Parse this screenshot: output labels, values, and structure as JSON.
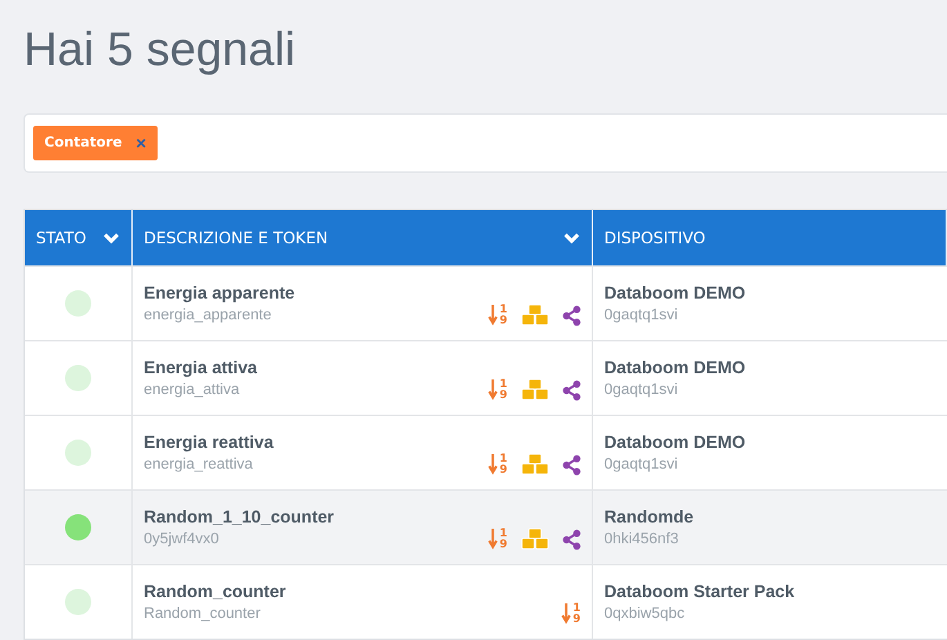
{
  "title": "Hai 5 segnali",
  "filters": [
    {
      "label": "Contatore",
      "remove": "×"
    }
  ],
  "table": {
    "columns": [
      {
        "label": "STATO",
        "sortable": true
      },
      {
        "label": "DESCRIZIONE E TOKEN",
        "sortable": true
      },
      {
        "label": "DISPOSITIVO",
        "sortable": false
      }
    ],
    "rows": [
      {
        "active": false,
        "highlighted": false,
        "name": "Energia apparente",
        "token": "energia_apparente",
        "icons": [
          {
            "kind": "numeric",
            "digits": [
              "1",
              "9"
            ]
          },
          {
            "kind": "cubes"
          },
          {
            "kind": "share"
          }
        ],
        "device": "Databoom DEMO",
        "device_token": "0gaqtq1svi"
      },
      {
        "active": false,
        "highlighted": false,
        "name": "Energia attiva",
        "token": "energia_attiva",
        "icons": [
          {
            "kind": "numeric",
            "digits": [
              "1",
              "9"
            ]
          },
          {
            "kind": "cubes"
          },
          {
            "kind": "share"
          }
        ],
        "device": "Databoom DEMO",
        "device_token": "0gaqtq1svi"
      },
      {
        "active": false,
        "highlighted": false,
        "name": "Energia reattiva",
        "token": "energia_reattiva",
        "icons": [
          {
            "kind": "numeric",
            "digits": [
              "1",
              "9"
            ]
          },
          {
            "kind": "cubes"
          },
          {
            "kind": "share"
          }
        ],
        "device": "Databoom DEMO",
        "device_token": "0gaqtq1svi"
      },
      {
        "active": true,
        "highlighted": true,
        "name": "Random_1_10_counter",
        "token": "0y5jwf4vx0",
        "icons": [
          {
            "kind": "numeric",
            "digits": [
              "1",
              "9"
            ]
          },
          {
            "kind": "cubes"
          },
          {
            "kind": "share"
          }
        ],
        "device": "Randomde",
        "device_token": "0hki456nf3"
      },
      {
        "active": false,
        "highlighted": false,
        "name": "Random_counter",
        "token": "Random_counter",
        "icons": [
          {
            "kind": "numeric",
            "digits": [
              "1",
              "9"
            ]
          }
        ],
        "device": "Databoom Starter Pack",
        "device_token": "0qxbiw5qbc"
      }
    ]
  }
}
